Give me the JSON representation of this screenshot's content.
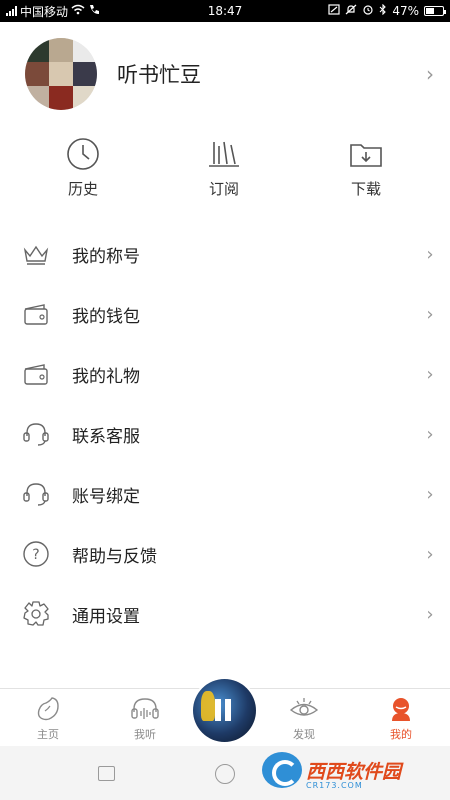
{
  "status_bar": {
    "carrier": "中国移动",
    "time": "18:47",
    "battery_text": "47%",
    "battery_level": 0.47
  },
  "profile": {
    "username": "听书忙豆"
  },
  "quick_actions": [
    {
      "label": "历史",
      "icon": "clock-icon"
    },
    {
      "label": "订阅",
      "icon": "books-icon"
    },
    {
      "label": "下载",
      "icon": "download-folder-icon"
    }
  ],
  "menu": [
    {
      "label": "我的称号",
      "icon": "crown-icon"
    },
    {
      "label": "我的钱包",
      "icon": "wallet-icon"
    },
    {
      "label": "我的礼物",
      "icon": "wallet-icon"
    },
    {
      "label": "联系客服",
      "icon": "headset-icon"
    },
    {
      "label": "账号绑定",
      "icon": "headset-icon"
    },
    {
      "label": "帮助与反馈",
      "icon": "help-icon"
    },
    {
      "label": "通用设置",
      "icon": "gear-icon"
    }
  ],
  "bottom_nav": {
    "home": "主页",
    "listen": "我听",
    "discover": "发现",
    "mine": "我的",
    "active": "mine"
  },
  "watermark": {
    "brand": "西西软件园",
    "domain": "CR173.COM"
  },
  "colors": {
    "accent": "#e8532b",
    "icon_gray": "#8a8a8a"
  }
}
